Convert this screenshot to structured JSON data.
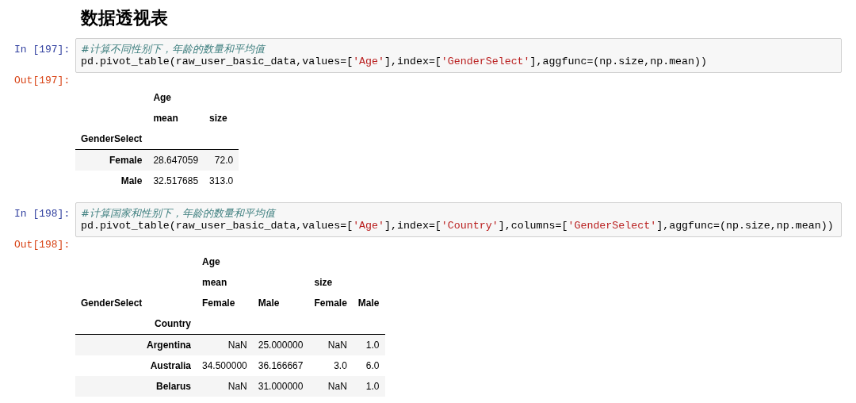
{
  "heading": "数据透视表",
  "cells": [
    {
      "input_prompt": "In [197]:",
      "comment": "#计算不同性别下，年龄的数量和平均值",
      "code": [
        {
          "kind": "plain",
          "text": "pd.pivot_table(raw_user_basic_data,values=["
        },
        {
          "kind": "string",
          "text": "'Age'"
        },
        {
          "kind": "plain",
          "text": "],index=["
        },
        {
          "kind": "string",
          "text": "'GenderSelect'"
        },
        {
          "kind": "plain",
          "text": "],aggfunc=(np.size,np.mean))"
        }
      ],
      "output_prompt": "Out[197]:",
      "table": {
        "header_rows": [
          [
            null,
            "Age",
            null
          ],
          [
            null,
            "mean",
            "size"
          ],
          [
            "GenderSelect",
            null,
            null
          ]
        ],
        "rows": [
          {
            "index": "Female",
            "values": [
              "28.647059",
              "72.0"
            ]
          },
          {
            "index": "Male",
            "values": [
              "32.517685",
              "313.0"
            ]
          }
        ]
      }
    },
    {
      "input_prompt": "In [198]:",
      "comment": "#计算国家和性别下，年龄的数量和平均值",
      "code": [
        {
          "kind": "plain",
          "text": "pd.pivot_table(raw_user_basic_data,values=["
        },
        {
          "kind": "string",
          "text": "'Age'"
        },
        {
          "kind": "plain",
          "text": "],index=["
        },
        {
          "kind": "string",
          "text": "'Country'"
        },
        {
          "kind": "plain",
          "text": "],columns=["
        },
        {
          "kind": "string",
          "text": "'GenderSelect'"
        },
        {
          "kind": "plain",
          "text": "],aggfunc=(np.size,np.mean))"
        }
      ],
      "output_prompt": "Out[198]:",
      "table": {
        "header_rows": [
          [
            null,
            "Age",
            null,
            null,
            null
          ],
          [
            null,
            "mean",
            null,
            "size",
            null
          ],
          [
            "GenderSelect",
            "Female",
            "Male",
            "Female",
            "Male"
          ]
        ],
        "index_name": "Country",
        "rows": [
          {
            "index": "Argentina",
            "values": [
              "NaN",
              "25.000000",
              "NaN",
              "1.0"
            ]
          },
          {
            "index": "Australia",
            "values": [
              "34.500000",
              "36.166667",
              "3.0",
              "6.0"
            ]
          },
          {
            "index": "Belarus",
            "values": [
              "NaN",
              "31.000000",
              "NaN",
              "1.0"
            ]
          }
        ]
      }
    }
  ]
}
